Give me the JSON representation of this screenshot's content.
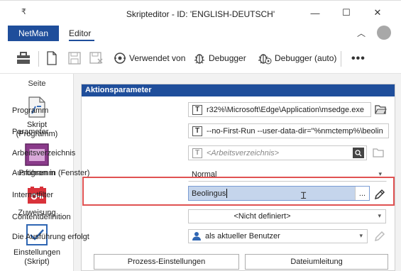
{
  "window": {
    "menu_glyph": "₹",
    "title": "Skripteditor - ID: 'ENGLISH-DEUTSCH'",
    "minimize": "—",
    "maximize": "☐",
    "close": "✕"
  },
  "tabs": {
    "netman": "NetMan",
    "editor": "Editor",
    "collapse": "︿"
  },
  "toolbar": {
    "uses_label": "Verwendet von",
    "debugger_label": "Debugger",
    "debugger_auto_label": "Debugger (auto)",
    "more_label": "•••"
  },
  "sidebar": {
    "heading": "Seite",
    "items": [
      {
        "label": "Skript\n(Programm)"
      },
      {
        "label": "Programm"
      },
      {
        "label": "Zuweisung"
      },
      {
        "label": "Einstellungen\n(Skript)"
      }
    ]
  },
  "panel": {
    "title": "Aktionsparameter",
    "fields": {
      "programm": {
        "label": "Programm",
        "type_icon": "T",
        "value": "r32%\\Microsoft\\Edge\\Application\\msedge.exe"
      },
      "parameter": {
        "label": "Parameter",
        "type_icon": "T",
        "value": "--no-First-Run --user-data-dir=\"%nmctemp%\\beolin"
      },
      "arbeitsverzeichnis": {
        "label": "Arbeitsverzeichnis",
        "type_icon": "T",
        "placeholder": "<Arbeitsverzeichnis>"
      },
      "ausfuehren": {
        "label": "Ausführen in (Fenster)",
        "value": "Normal"
      },
      "internetfilter": {
        "label": "Internetfilter",
        "value": "Beolingus",
        "ellipsis": "..."
      },
      "contentdefinition": {
        "label": "Contentdefinition",
        "value": "<Nicht definiert>"
      },
      "ausfuehrung": {
        "label": "Die Ausführung erfolgt",
        "value": "als aktueller Benutzer"
      }
    },
    "buttons": {
      "prozess": "Prozess-Einstellungen",
      "dateiumleitung": "Dateiumleitung"
    }
  },
  "colors": {
    "accent": "#1f4e9b",
    "highlight": "#e05252",
    "selection": "#c5d5ec"
  }
}
